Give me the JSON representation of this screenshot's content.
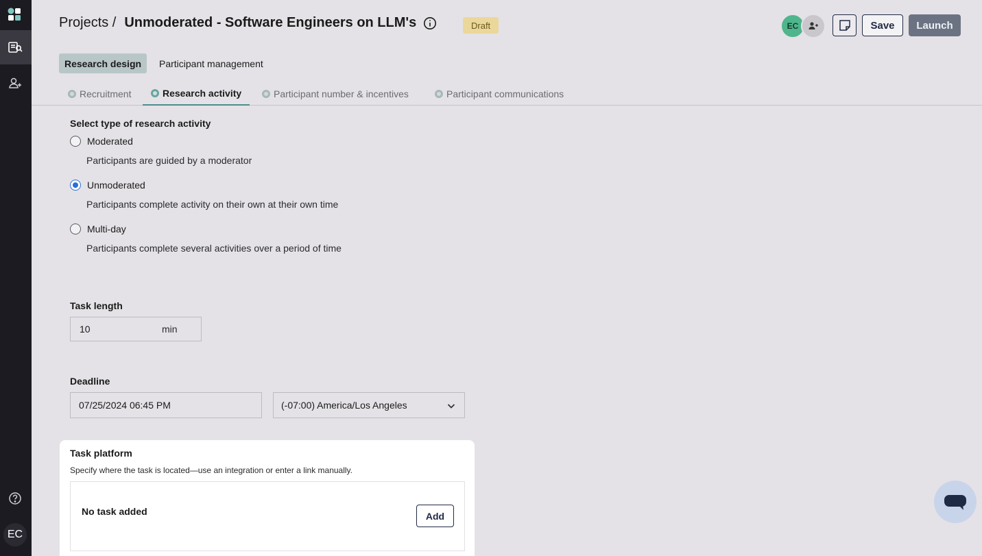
{
  "header": {
    "breadcrumb_root": "Projects /",
    "project_title": "Unmoderated - Software Engineers on LLM's",
    "status_badge": "Draft",
    "avatar_initials": "EC",
    "save_label": "Save",
    "launch_label": "Launch"
  },
  "main_tabs": [
    {
      "label": "Research design",
      "active": true
    },
    {
      "label": "Participant management",
      "active": false
    }
  ],
  "sub_tabs": [
    {
      "label": "Recruitment",
      "active": false
    },
    {
      "label": "Research activity",
      "active": true
    },
    {
      "label": "Participant number & incentives",
      "active": false
    },
    {
      "label": "Participant communications",
      "active": false
    }
  ],
  "research_activity": {
    "label": "Select type of research activity",
    "options": [
      {
        "label": "Moderated",
        "description": "Participants are guided by a moderator",
        "selected": false
      },
      {
        "label": "Unmoderated",
        "description": "Participants complete activity on their own at their own time",
        "selected": true
      },
      {
        "label": "Multi-day",
        "description": "Participants complete several activities over a period of time",
        "selected": false
      }
    ]
  },
  "task_length": {
    "label": "Task length",
    "value": "10",
    "unit": "min"
  },
  "deadline": {
    "label": "Deadline",
    "datetime": "07/25/2024 06:45 PM",
    "timezone": "(-07:00) America/Los Angeles"
  },
  "task_platform": {
    "title": "Task platform",
    "description": "Specify where the task is located—use an integration or enter a link manually.",
    "empty_text": "No task added",
    "add_label": "Add"
  },
  "sidebar": {
    "user_initials": "EC",
    "icons": [
      "app-logo-icon",
      "research-icon",
      "participants-icon",
      "help-icon"
    ]
  },
  "colors": {
    "accent_teal": "#4b8f8c",
    "radio_blue": "#2a6fd6",
    "draft_badge": "#ecd79a",
    "launch_disabled": "#6b7383"
  }
}
